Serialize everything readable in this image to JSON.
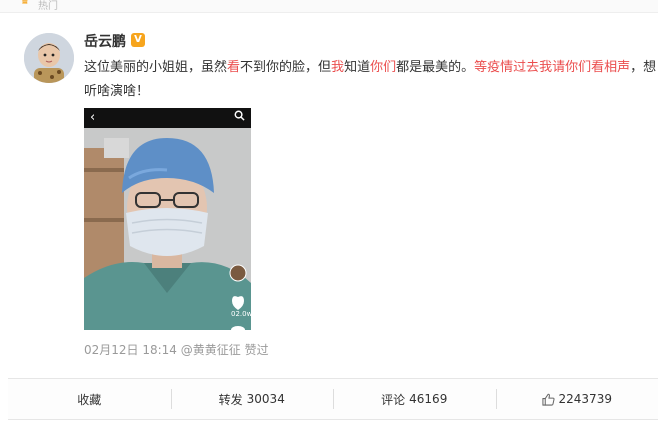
{
  "header": {
    "hot_label": "热门"
  },
  "post": {
    "author": "岳云鹏",
    "verified_badge": "V",
    "text_parts": {
      "p1": "这位美丽的小姐姐，虽然",
      "p2": "看",
      "p3": "不到你的脸，但",
      "p4": "我",
      "p5": "知道",
      "p6": "你们",
      "p7": "都是最美的。",
      "p8": "等疫情过去我请你们看相声",
      "p9": "，想听啥演啥！"
    },
    "meta": {
      "date": "02月12日 18:14",
      "liker": "@黄黄征征",
      "liked_label": "赞过"
    },
    "video": {
      "counter": "02.0w"
    }
  },
  "actions": {
    "favorite_label": "收藏",
    "repost_label": "转发",
    "repost_count": "30034",
    "comment_label": "评论",
    "comment_count": "46169",
    "like_count": "2243739"
  },
  "colors": {
    "highlight": "#eb4e4e",
    "vip": "#f7a51d",
    "meta": "#9a9a9a"
  }
}
